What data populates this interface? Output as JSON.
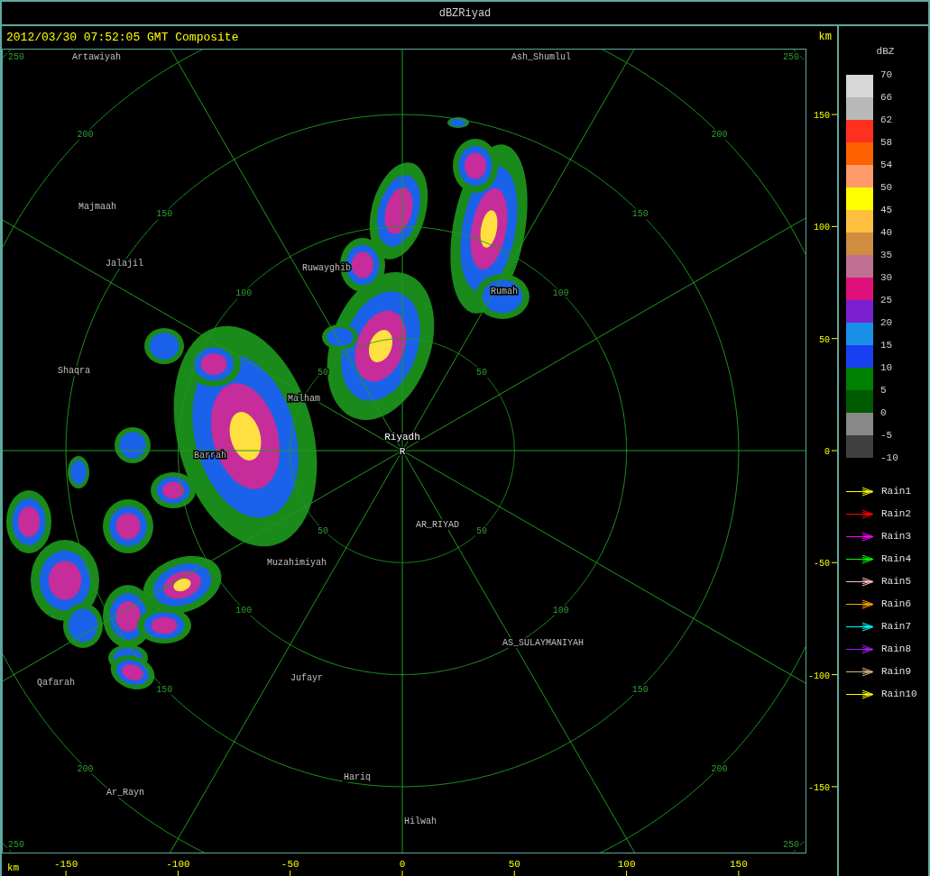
{
  "window": {
    "title": "dBZRiyad"
  },
  "header": {
    "timestamp": "2012/03/30 07:52:05 GMT Composite",
    "unit": "km"
  },
  "map": {
    "radar_site": {
      "name": "Riyadh",
      "marker": "R"
    },
    "places": [
      {
        "name": "Artawiyah"
      },
      {
        "name": "Ash_Shumlul"
      },
      {
        "name": "Majmaah"
      },
      {
        "name": "Jalajil"
      },
      {
        "name": "Ruwayghib"
      },
      {
        "name": "Rumah"
      },
      {
        "name": "Shaqra"
      },
      {
        "name": "Malham"
      },
      {
        "name": "Barrah"
      },
      {
        "name": "AR_RIYAD"
      },
      {
        "name": "Muzahimiyah"
      },
      {
        "name": "AS_SULAYMANIYAH"
      },
      {
        "name": "Qafarah"
      },
      {
        "name": "Jufayr"
      },
      {
        "name": "Hariq"
      },
      {
        "name": "Ar_Rayn"
      },
      {
        "name": "Hilwah"
      }
    ],
    "range_rings": [
      {
        "labels": [
          "50",
          "50",
          "50",
          "50"
        ]
      },
      {
        "labels": [
          "100",
          "100",
          "100",
          "100"
        ]
      },
      {
        "labels": [
          "150",
          "150",
          "150",
          "150"
        ]
      },
      {
        "labels": [
          "200",
          "200",
          "200",
          "200"
        ]
      },
      {
        "labels": [
          "250",
          "250",
          "250",
          "250"
        ]
      }
    ],
    "y_axis": {
      "ticks": [
        "150",
        "100",
        "50",
        "0",
        "-50",
        "-100",
        "-150"
      ]
    },
    "x_axis": {
      "unit": "km",
      "ticks": [
        "-150",
        "-100",
        "-50",
        "0",
        "50",
        "100",
        "150"
      ]
    }
  },
  "color_scale": {
    "unit": "dBZ",
    "bands": [
      {
        "color": "#d8d8d8"
      },
      {
        "color": "#b8b8b8"
      },
      {
        "color": "#ff3020"
      },
      {
        "color": "#ff6000"
      },
      {
        "color": "#ff9a6a"
      },
      {
        "color": "#ffff00"
      },
      {
        "color": "#ffc040"
      },
      {
        "color": "#d08c40"
      },
      {
        "color": "#c07090"
      },
      {
        "color": "#e0107a"
      },
      {
        "color": "#7a20d0"
      },
      {
        "color": "#1890e8"
      },
      {
        "color": "#1840f0"
      },
      {
        "color": "#008000"
      },
      {
        "color": "#005a00"
      },
      {
        "color": "#888888"
      },
      {
        "color": "#404040"
      }
    ],
    "ticks": [
      "70",
      "66",
      "62",
      "58",
      "54",
      "50",
      "45",
      "40",
      "35",
      "30",
      "25",
      "20",
      "15",
      "10",
      "5",
      "0",
      "-5",
      "-10"
    ]
  },
  "rain_legend": [
    {
      "label": "Rain1",
      "color": "#ffff00"
    },
    {
      "label": "Rain2",
      "color": "#ff0000"
    },
    {
      "label": "Rain3",
      "color": "#ff00ff"
    },
    {
      "label": "Rain4",
      "color": "#00ff00"
    },
    {
      "label": "Rain5",
      "color": "#ffc0c0"
    },
    {
      "label": "Rain6",
      "color": "#ffa500"
    },
    {
      "label": "Rain7",
      "color": "#00ffff"
    },
    {
      "label": "Rain8",
      "color": "#a020f0"
    },
    {
      "label": "Rain9",
      "color": "#d2b48c"
    },
    {
      "label": "Rain10",
      "color": "#ffff00"
    }
  ]
}
